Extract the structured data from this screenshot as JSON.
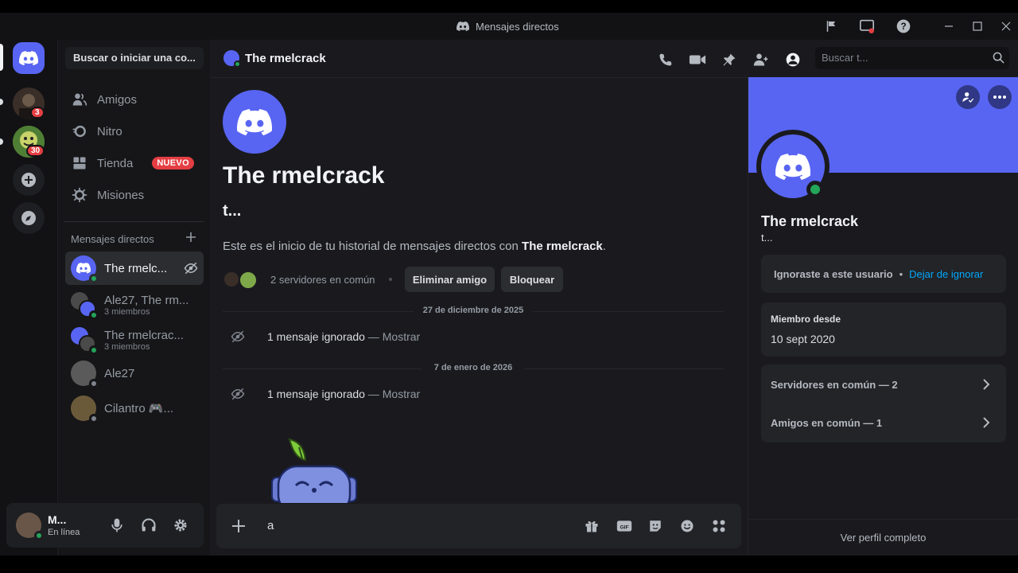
{
  "window": {
    "title": "Mensajes directos"
  },
  "rail": {
    "servers": [
      {
        "name": "server-1",
        "badge": "3"
      },
      {
        "name": "server-2",
        "badge": "30"
      }
    ]
  },
  "sidebar": {
    "search_placeholder": "Buscar o iniciar una co...",
    "nav": [
      {
        "label": "Amigos",
        "icon": "friends-icon"
      },
      {
        "label": "Nitro",
        "icon": "nitro-icon"
      },
      {
        "label": "Tienda",
        "icon": "shop-icon",
        "badge": "NUEVO"
      },
      {
        "label": "Misiones",
        "icon": "quests-icon"
      }
    ],
    "dm_header": "Mensajes directos",
    "dms": [
      {
        "name": "The rmelc...",
        "sub": ""
      },
      {
        "name": "Ale27, The rm...",
        "sub": "3 miembros"
      },
      {
        "name": "The rmelcrac...",
        "sub": "3 miembros"
      },
      {
        "name": "Ale27",
        "sub": ""
      },
      {
        "name": "Cilantro 🎮...",
        "sub": ""
      }
    ]
  },
  "user": {
    "name": "M...",
    "status": "En línea"
  },
  "chat": {
    "header_name": "The rmelcrack",
    "search_placeholder": "Buscar t...",
    "intro_name": "The rmelcrack",
    "intro_handle": "t...",
    "intro_text_prefix": "Este es el inicio de tu historial de mensajes directos con ",
    "intro_text_name": "The rmelcrack",
    "intro_text_suffix": ".",
    "mutual_servers": "2 servidores en común",
    "remove_friend": "Eliminar amigo",
    "block": "Bloquear",
    "dates": [
      "27 de diciembre de 2025",
      "7 de enero de 2026"
    ],
    "ignored_label": "1 mensaje ignorado",
    "ignored_sep": " — ",
    "show_label": "Mostrar",
    "composer_value": "a"
  },
  "profile": {
    "name": "The rmelcrack",
    "handle": "t...",
    "ignored_text": "Ignoraste a este usuario",
    "unignore": "Dejar de ignorar",
    "member_since_label": "Miembro desde",
    "member_since": "10 sept 2020",
    "mutual_servers": "Servidores en común — 2",
    "mutual_friends": "Amigos en común — 1",
    "full_profile": "Ver perfil completo",
    "banner_color": "#5865f2"
  },
  "colors": {
    "brand": "#5865f2",
    "online": "#23a55a",
    "danger": "#e43e43",
    "link": "#00a8fc"
  }
}
